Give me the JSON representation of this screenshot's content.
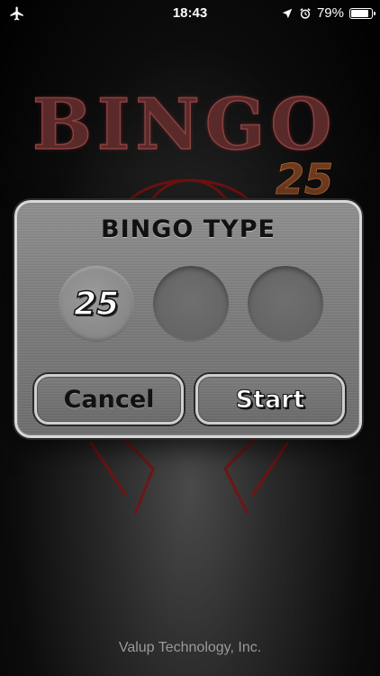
{
  "status_bar": {
    "time": "18:43",
    "battery_percent": "79%",
    "battery_level": 0.79,
    "icons": [
      "airplane-icon",
      "location-arrow-icon",
      "alarm-clock-icon",
      "battery-icon"
    ]
  },
  "background": {
    "title": "BINGO",
    "number": "25"
  },
  "dialog": {
    "title": "BINGO TYPE",
    "options": [
      {
        "label": "25",
        "selected": true
      },
      {
        "label": "",
        "selected": false
      },
      {
        "label": "",
        "selected": false
      }
    ],
    "cancel_label": "Cancel",
    "start_label": "Start"
  },
  "footer": {
    "text": "Valup Technology, Inc."
  }
}
